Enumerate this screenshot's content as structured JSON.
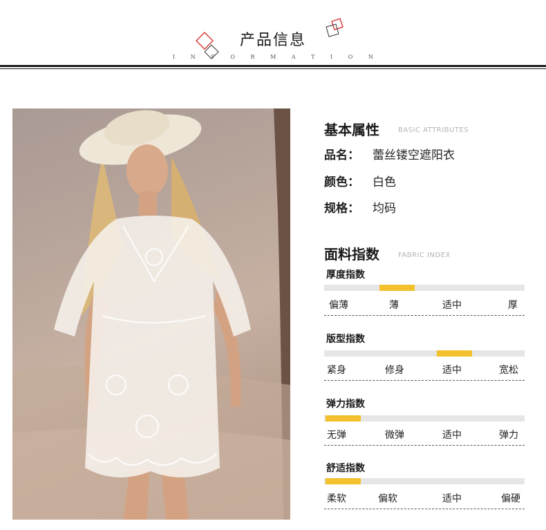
{
  "header": {
    "title": "产品信息",
    "subtitle_letters": [
      "I",
      "N",
      "F",
      "O",
      "R",
      "M",
      "A",
      "T",
      "I",
      "O",
      "N"
    ]
  },
  "colors": {
    "accent": "#f3c12d",
    "track": "#e6e6e6",
    "deco_red": "#d8342f"
  },
  "basic": {
    "title": "基本属性",
    "title_en": "BASIC ATTRIBUTES",
    "items": [
      {
        "key": "品名：",
        "value": "蕾丝镂空遮阳衣"
      },
      {
        "key": "颜色：",
        "value": "白色"
      },
      {
        "key": "规格：",
        "value": "均码"
      }
    ]
  },
  "fabric": {
    "title": "面料指数",
    "title_en": "FABRIC INDEX",
    "metrics": [
      {
        "name": "厚度指数",
        "labels": [
          "偏薄",
          "薄",
          "适中",
          "厚"
        ],
        "selected": 1
      },
      {
        "name": "版型指数",
        "labels": [
          "紧身",
          "修身",
          "适中",
          "宽松"
        ],
        "selected": 2
      },
      {
        "name": "弹力指数",
        "labels": [
          "无弹",
          "微弹",
          "适中",
          "弹力"
        ],
        "selected": 0
      },
      {
        "name": "舒适指数",
        "labels": [
          "柔软",
          "偏软",
          "适中",
          "偏硬"
        ],
        "selected": 0
      }
    ]
  }
}
